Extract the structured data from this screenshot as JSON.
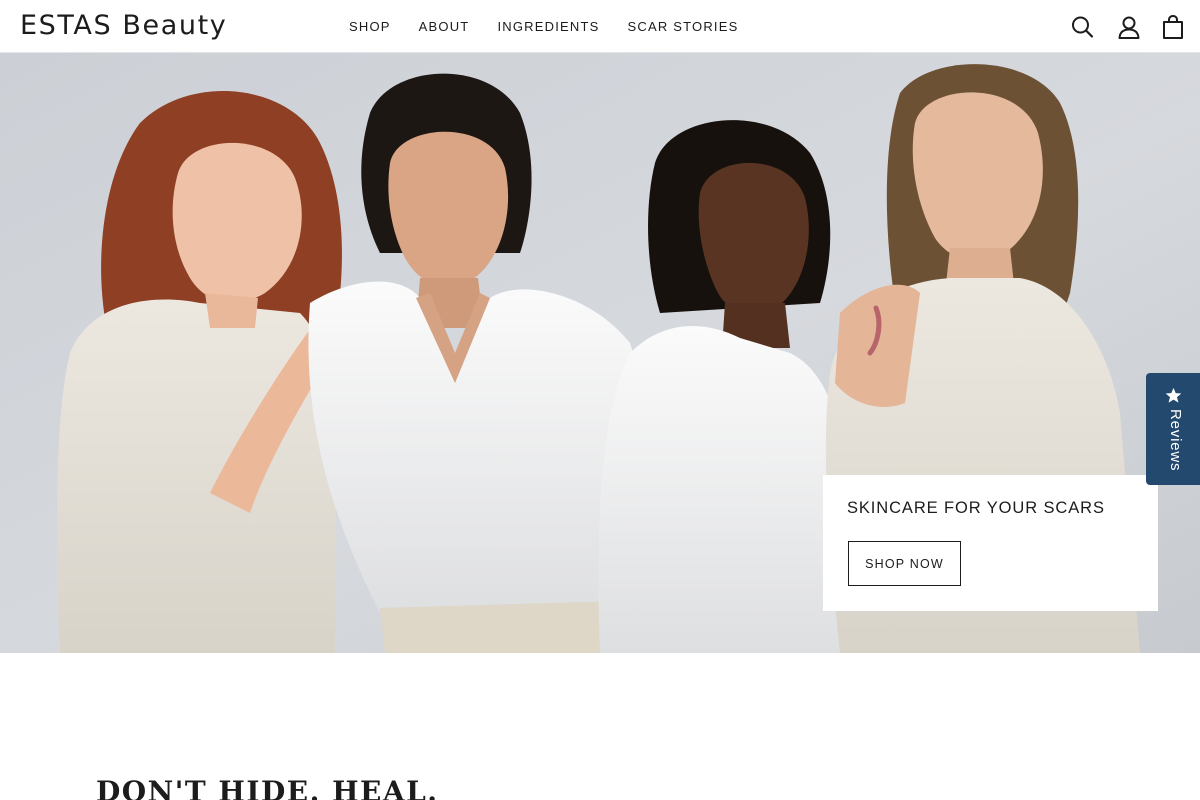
{
  "brand": {
    "name": "ESTAS Beauty"
  },
  "nav": {
    "items": [
      {
        "label": "SHOP"
      },
      {
        "label": "ABOUT"
      },
      {
        "label": "INGREDIENTS"
      },
      {
        "label": "SCAR STORIES"
      }
    ]
  },
  "header_icons": [
    "search-icon",
    "account-icon",
    "cart-icon"
  ],
  "hero": {
    "heading": "SKINCARE FOR YOUR SCARS",
    "cta_label": "SHOP NOW",
    "image_alt": "Four women with visible scars posing together in light-colored shirts"
  },
  "reviews_tab": {
    "label": "Reviews",
    "icon": "star-icon",
    "color": "#24496f"
  },
  "section": {
    "heading": "DON'T HIDE. HEAL."
  },
  "colors": {
    "text": "#1c1c1c",
    "background": "#ffffff",
    "hero_backdrop": "#d4d7db"
  }
}
